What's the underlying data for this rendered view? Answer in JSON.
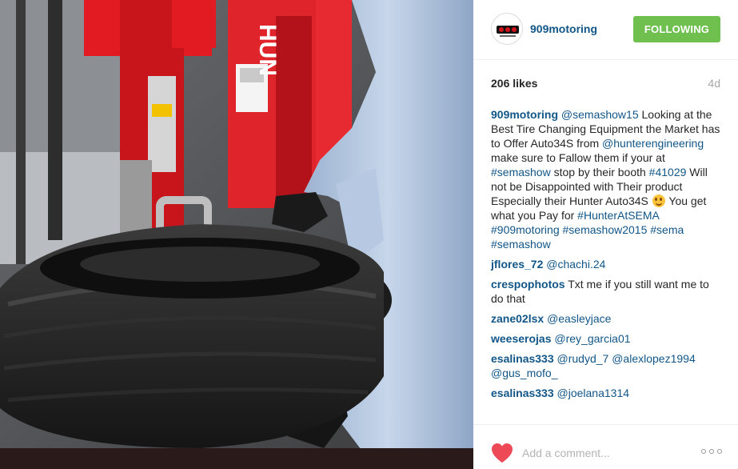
{
  "colors": {
    "link": "#125688",
    "follow_button": "#70c050",
    "heart": "#ed4956",
    "muted": "#a5a7aa"
  },
  "media": {
    "kind": "video-still",
    "machine_brand_text": "HUN"
  },
  "header": {
    "username": "909motoring",
    "follow_label": "FOLLOWING",
    "avatar_icon": "profile-logo-icon"
  },
  "post": {
    "likes": "206 likes",
    "time_ago": "4d"
  },
  "caption": {
    "author": "909motoring",
    "segments": [
      "@semashow15",
      " Looking at the Best Tire Changing Equipment the Market has to Offer Auto34S from ",
      "@hunterengineering",
      " make sure to Fallow them if your at ",
      "#semashow",
      " stop by their booth ",
      "#41029",
      " Will not be Disappointed with Their product Especially their Hunter Auto34S ",
      " You get what you Pay for ",
      "#HunterAtSEMA",
      " ",
      "#909motoring",
      " ",
      "#semashow2015",
      " ",
      "#sema",
      " ",
      "#semashow"
    ],
    "emoji_icon": "smiling-face-emoji-icon"
  },
  "comments": [
    {
      "author": "jflores_72",
      "parts": [
        " ",
        "@chachi.24"
      ]
    },
    {
      "author": "crespophotos",
      "parts": [
        " Txt me if you still want me to do that"
      ]
    },
    {
      "author": "zane02lsx",
      "parts": [
        " ",
        "@easleyjace"
      ]
    },
    {
      "author": "weeserojas",
      "parts": [
        " ",
        "@rey_garcia01"
      ]
    },
    {
      "author": "esalinas333",
      "parts": [
        " ",
        "@rudyd_7",
        " ",
        "@alexlopez1994",
        " ",
        "@gus_mofo_"
      ]
    },
    {
      "author": "esalinas333",
      "parts": [
        " ",
        "@joelana1314"
      ]
    }
  ],
  "footer": {
    "like_icon": "heart-icon",
    "comment_placeholder": "Add a comment...",
    "more_icon": "more-options-icon"
  }
}
